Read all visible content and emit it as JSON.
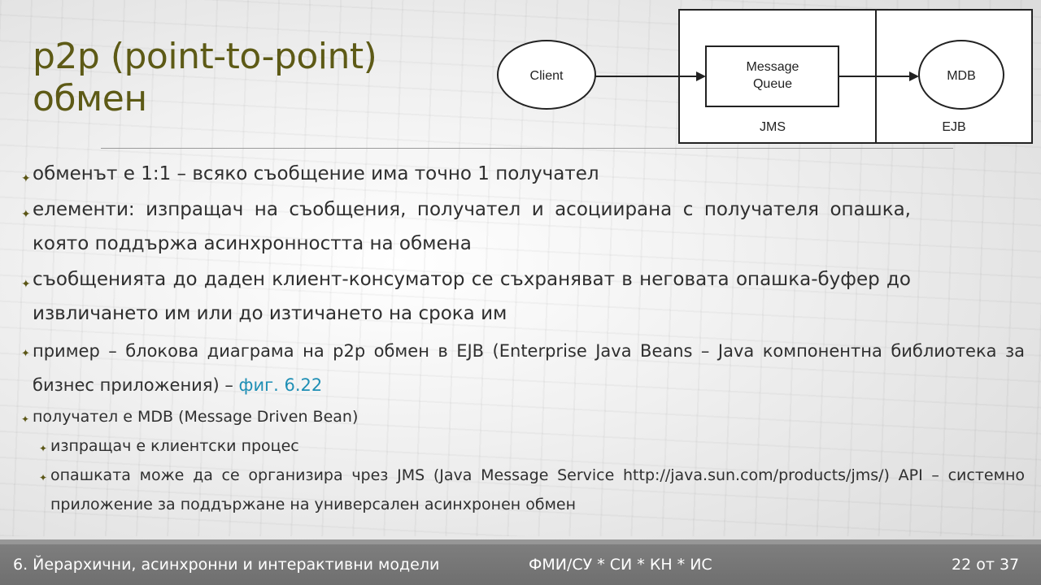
{
  "title": {
    "line1": "p2p (point-to-point)",
    "line2": "обмен"
  },
  "diagram": {
    "client": "Client",
    "queue_line1": "Message",
    "queue_line2": "Queue",
    "mdb": "MDB",
    "jms": "JMS",
    "ejb": "EJB"
  },
  "bullets": {
    "b1": "обменът е 1:1 – всяко съобщение има точно 1 получател",
    "b2": "елементи: изпращач на съобщения, получател и асоциирана с получателя опашка, която поддържа асинхронността на обмена",
    "b3": "съобщенията до даден клиент-консуматор се съхраняват в неговата опашка-буфер до извличането им или до изтичането на срока им",
    "b4_text": "пример – блокова диаграма на p2p обмен в EJB (Enterprise Java Beans – Java компонентна библиотека за бизнес приложения) – ",
    "b4_link": "фиг. 6.22",
    "b5": "получател е MDB (Message Driven Bean)",
    "b6": "изпращач е клиентски процес",
    "b7": "опашката може да се организира чрез JMS (Java Message Service http://java.sun.com/products/jms/) API – системно приложение за поддържане на универсален асинхронен обмен"
  },
  "footer": {
    "left": "6. Йерархични, асинхронни и интерактивни модели",
    "middle": "ФМИ/СУ  *  СИ  * КН * ИС",
    "right": "22 от 37"
  },
  "colors": {
    "title": "#5d5a16",
    "link": "#1f8fb5",
    "footer_bg": "#747474"
  }
}
